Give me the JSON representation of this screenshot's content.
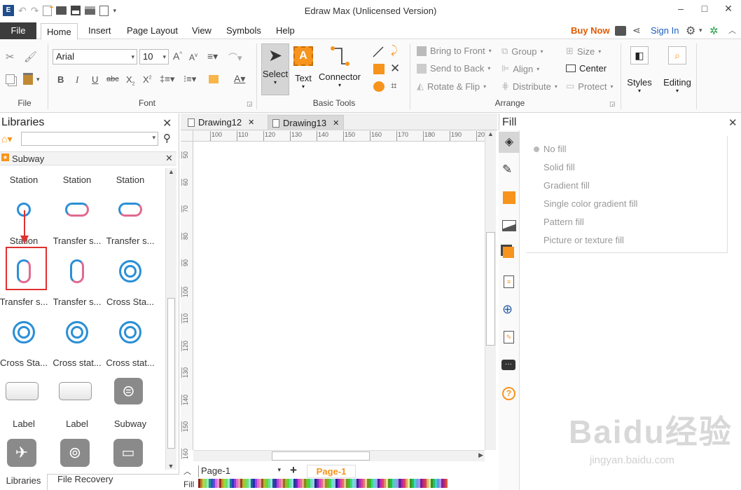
{
  "window": {
    "title": "Edraw Max (Unlicensed Version)"
  },
  "menu": {
    "file": "File",
    "tabs": [
      "Home",
      "Insert",
      "Page Layout",
      "View",
      "Symbols",
      "Help"
    ],
    "buy_now": "Buy Now",
    "sign_in": "Sign In"
  },
  "ribbon": {
    "file_group": "File",
    "font_group": "Font",
    "font_name": "Arial",
    "font_size": "10",
    "basic_tools_group": "Basic Tools",
    "select": "Select",
    "text": "Text",
    "connector": "Connector",
    "arrange_group": "Arrange",
    "bring_to_front": "Bring to Front",
    "send_to_back": "Send to Back",
    "rotate_flip": "Rotate & Flip",
    "group": "Group",
    "align": "Align",
    "distribute": "Distribute",
    "size": "Size",
    "center": "Center",
    "protect": "Protect",
    "styles": "Styles",
    "editing": "Editing"
  },
  "libraries": {
    "title": "Libraries",
    "category": "Subway",
    "row_labels": [
      [
        "Station",
        "Station",
        "Station"
      ],
      [
        "Station",
        "Transfer s...",
        "Transfer s..."
      ],
      [
        "Transfer s...",
        "Transfer s...",
        "Cross Sta..."
      ],
      [
        "Cross Sta...",
        "Cross stat...",
        "Cross stat..."
      ],
      [
        "Label",
        "Label",
        "Subway"
      ]
    ],
    "tab_libraries": "Libraries",
    "tab_recovery": "File Recovery"
  },
  "documents": {
    "tabs": [
      "Drawing12",
      "Drawing13"
    ]
  },
  "ruler": {
    "h_ticks": [
      "100",
      "110",
      "120",
      "130",
      "140",
      "150",
      "160",
      "170",
      "180",
      "190",
      "200"
    ],
    "v_ticks": [
      "50",
      "60",
      "70",
      "80",
      "90",
      "100",
      "110",
      "120",
      "130",
      "140",
      "150",
      "160"
    ]
  },
  "pages": {
    "current": "Page-1",
    "tab": "Page-1",
    "fill_label": "Fill"
  },
  "fill": {
    "title": "Fill",
    "options": [
      "No fill",
      "Solid fill",
      "Gradient fill",
      "Single color gradient fill",
      "Pattern fill",
      "Picture or texture fill"
    ]
  },
  "watermark": {
    "main": "Baidu经验",
    "sub": "jingyan.baidu.com"
  },
  "colors": {
    "accent": "#f7941d",
    "subway_blue": "#2b8fd6",
    "subway_pink": "#e06b8f",
    "highlight": "#e03030"
  }
}
